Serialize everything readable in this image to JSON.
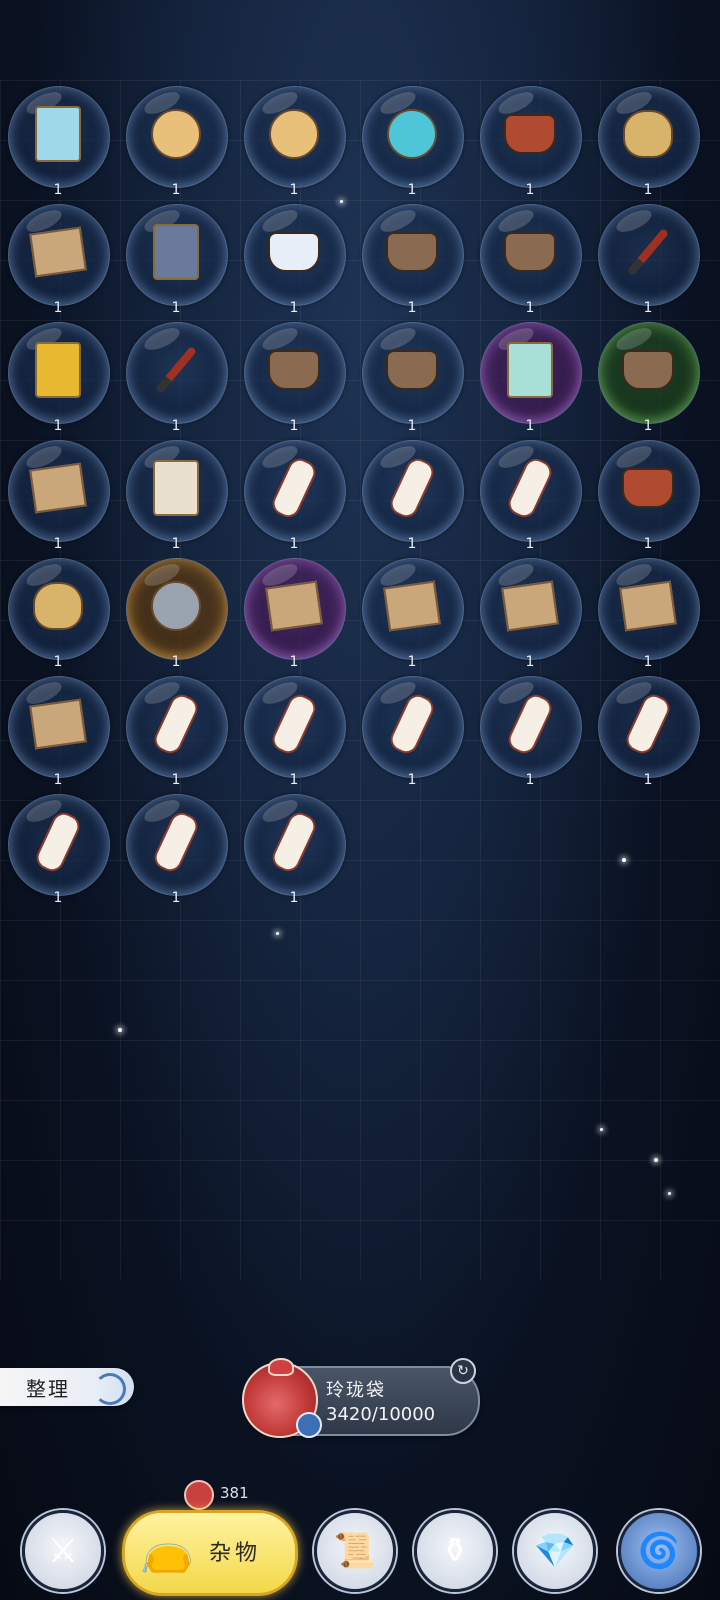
{
  "inventory": {
    "items": [
      {
        "name": "rain-talisman-icon",
        "qty": "1"
      },
      {
        "name": "jade-pendant-icon",
        "qty": "1"
      },
      {
        "name": "jade-pendant-icon",
        "qty": "1"
      },
      {
        "name": "crystal-mirror-icon",
        "qty": "1"
      },
      {
        "name": "wine-jar-icon",
        "qty": "1"
      },
      {
        "name": "cloth-bag-icon",
        "qty": "1"
      },
      {
        "name": "scroll-paper-icon",
        "qty": "1"
      },
      {
        "name": "flower-branch-icon",
        "qty": "1"
      },
      {
        "name": "porcelain-vase-icon",
        "qty": "1"
      },
      {
        "name": "teapot-icon",
        "qty": "1"
      },
      {
        "name": "bronze-cauldron-icon",
        "qty": "1"
      },
      {
        "name": "brush-icon",
        "qty": "1"
      },
      {
        "name": "golden-feather-icon",
        "qty": "1"
      },
      {
        "name": "brush-icon",
        "qty": "1"
      },
      {
        "name": "bronze-cauldron-icon",
        "qty": "1"
      },
      {
        "name": "teapot-icon",
        "qty": "1"
      },
      {
        "name": "amulet-icon",
        "qty": "1"
      },
      {
        "name": "bronze-cauldron-icon",
        "qty": "1"
      },
      {
        "name": "letter-scroll-icon",
        "qty": "1"
      },
      {
        "name": "conch-shell-icon",
        "qty": "1"
      },
      {
        "name": "plum-blossom-tag-icon",
        "qty": "1"
      },
      {
        "name": "chrysanthemum-tag-icon",
        "qty": "1"
      },
      {
        "name": "peony-tag-icon",
        "qty": "1"
      },
      {
        "name": "wine-jar-icon",
        "qty": "1"
      },
      {
        "name": "cloth-bag-icon",
        "qty": "1"
      },
      {
        "name": "gear-icon",
        "qty": "1"
      },
      {
        "name": "map-scroll-icon",
        "qty": "1"
      },
      {
        "name": "book-envelope-icon",
        "qty": "1"
      },
      {
        "name": "book-envelope-icon",
        "qty": "1"
      },
      {
        "name": "book-envelope-icon",
        "qty": "1"
      },
      {
        "name": "book-envelope-icon",
        "qty": "1"
      },
      {
        "name": "plum-blossom-tag-icon",
        "qty": "1"
      },
      {
        "name": "cherry-blossom-tag-icon",
        "qty": "1"
      },
      {
        "name": "orchid-tag-icon",
        "qty": "1"
      },
      {
        "name": "lotus-tag-icon",
        "qty": "1"
      },
      {
        "name": "lily-tag-icon",
        "qty": "1"
      },
      {
        "name": "osmanthus-tag-icon",
        "qty": "1"
      },
      {
        "name": "rose-tag-icon",
        "qty": "1"
      },
      {
        "name": "camellia-tag-icon",
        "qty": "1"
      }
    ]
  },
  "sort_button": {
    "label": "整理"
  },
  "bag": {
    "name": "玲珑袋",
    "capacity": "3420/10000"
  },
  "nav": {
    "active_label": "杂物",
    "active_count": "381",
    "tabs": [
      "sword-icon",
      "misc-bag-icon",
      "book-icon",
      "potion-icon",
      "crystal-icon",
      "swirl-icon"
    ]
  }
}
